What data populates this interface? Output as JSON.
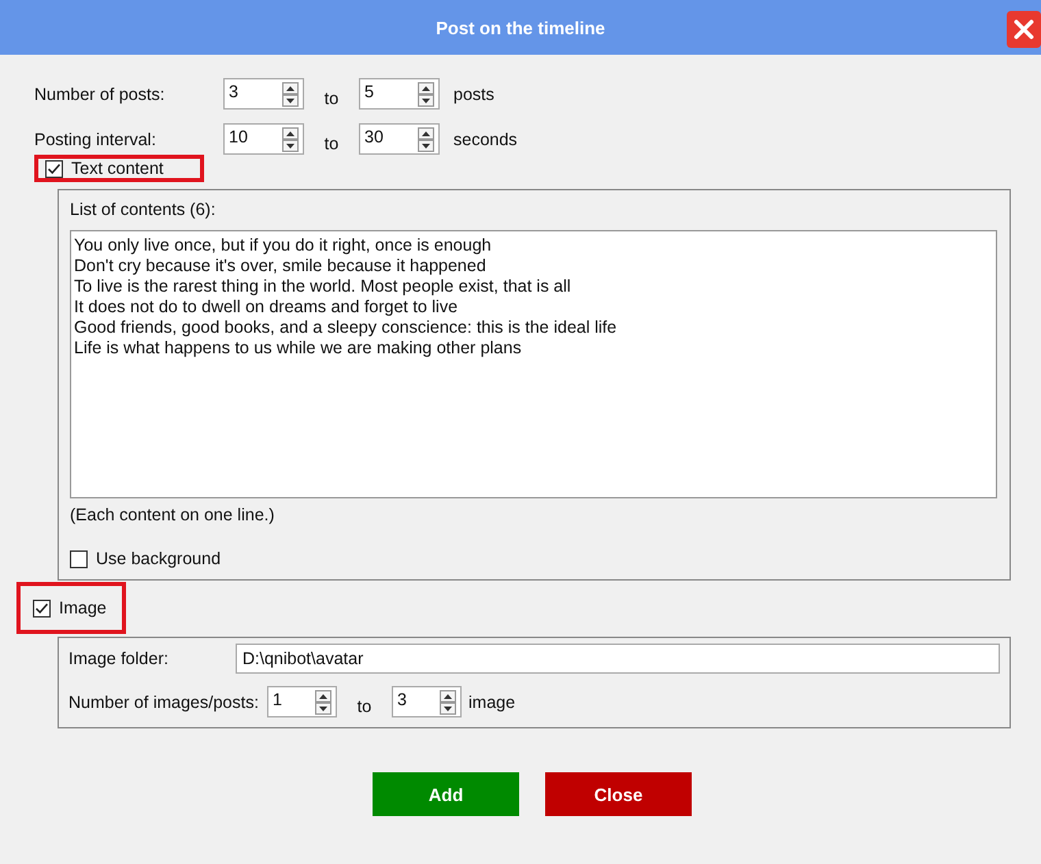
{
  "window": {
    "title": "Post on the timeline"
  },
  "settings_rows": [
    {
      "label": "Number of posts:",
      "from": "3",
      "to_label": "to",
      "to": "5",
      "unit": "posts"
    },
    {
      "label": "Posting interval:",
      "from": "10",
      "to_label": "to",
      "to": "30",
      "unit": "seconds"
    }
  ],
  "text_content": {
    "label": "Text content",
    "checked": true,
    "highlighted": true,
    "list_label": "List of contents (6):",
    "lines": [
      "You only live once, but if you do it right, once is enough",
      "Don't cry because it's over, smile because it happened",
      "To live is the rarest thing in the world. Most people exist, that is all",
      "It does not do to dwell on dreams and forget to live",
      "Good friends, good books, and a sleepy conscience: this is the ideal life",
      "Life is what happens to us while we are making other plans"
    ],
    "note": "(Each content on one line.)",
    "use_background": {
      "label": "Use background",
      "checked": false
    }
  },
  "image": {
    "label": "Image",
    "checked": true,
    "highlighted": true,
    "folder_label": "Image folder:",
    "folder": "D:\\qnibot\\avatar",
    "count_row": {
      "label": "Number of images/posts:",
      "from": "1",
      "to_label": "to",
      "to": "3",
      "unit": "image"
    }
  },
  "buttons": [
    {
      "label": "Add",
      "kind": "confirm"
    },
    {
      "label": "Close",
      "kind": "cancel"
    }
  ]
}
